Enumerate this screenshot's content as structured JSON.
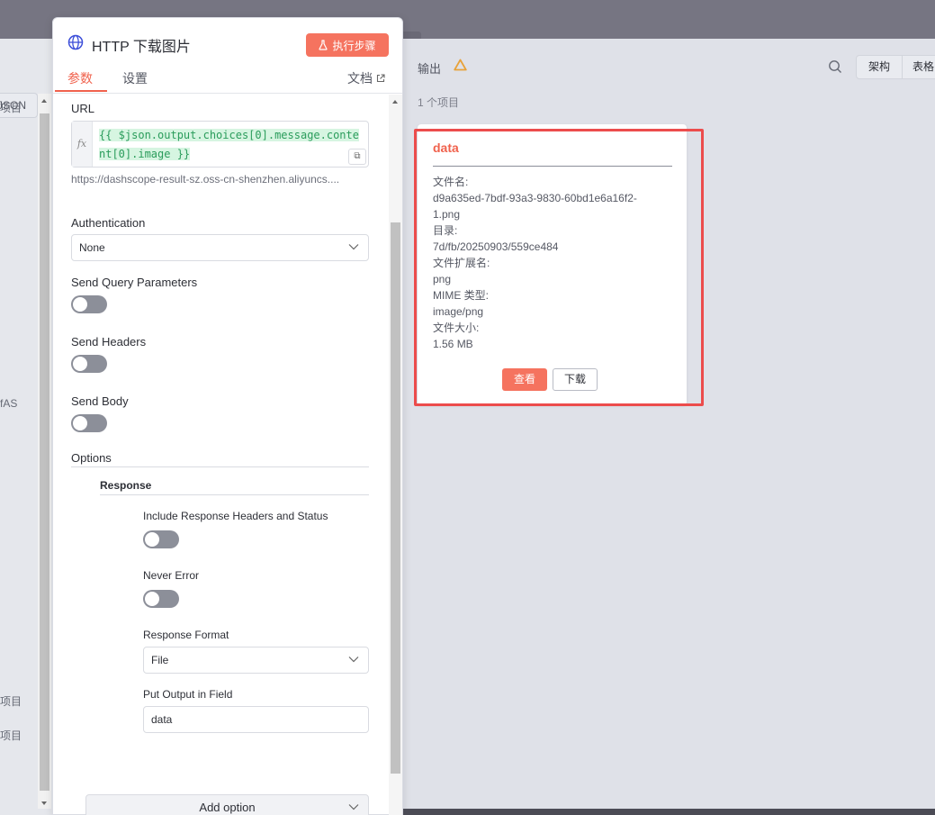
{
  "colors": {
    "accent": "#f0624d",
    "highlight": "#ec4c4c",
    "toggle_off": "#8c8f99",
    "warning": "#e8a23a"
  },
  "left_pane": {
    "json_label": "JSON",
    "items_top": "项目",
    "fas_text": "fAS",
    "items_bottom_1": "项目",
    "items_bottom_2": "项目"
  },
  "node_panel": {
    "icon": "globe-icon",
    "title": "HTTP 下载图片",
    "execute_label": "执行步骤",
    "execute_icon": "flask-icon",
    "tabs": [
      {
        "label": "参数",
        "active": true
      },
      {
        "label": "设置",
        "active": false
      }
    ],
    "docs_label": "文档",
    "url": {
      "label": "URL",
      "fx": "fx",
      "expression": "{{ $json.output.choices[0].message.content[0].image }}",
      "preview": "https://dashscope-result-sz.oss-cn-shenzhen.aliyuncs...."
    },
    "authentication": {
      "label": "Authentication",
      "value": "None"
    },
    "send_query": {
      "label": "Send Query Parameters",
      "enabled": false
    },
    "send_headers": {
      "label": "Send Headers",
      "enabled": false
    },
    "send_body": {
      "label": "Send Body",
      "enabled": false
    },
    "options": {
      "label": "Options",
      "response": {
        "label": "Response",
        "include_headers": {
          "label": "Include Response Headers and Status",
          "enabled": false
        },
        "never_error": {
          "label": "Never Error",
          "enabled": false
        },
        "response_format": {
          "label": "Response Format",
          "value": "File"
        },
        "output_field": {
          "label": "Put Output in Field",
          "value": "data"
        }
      },
      "add_option_label": "Add option"
    }
  },
  "output": {
    "label": "输出",
    "item_count": "1 个项目",
    "view_schema": "架构",
    "view_table": "表格",
    "binary": {
      "name": "data",
      "file_name_label": "文件名:",
      "file_name_1": "d9a635ed-7bdf-93a3-9830-60bd1e6a16f2-",
      "file_name_2": "1.png",
      "directory_label": "目录:",
      "directory": "7d/fb/20250903/559ce484",
      "ext_label": "文件扩展名:",
      "ext": "png",
      "mime_label": "MIME 类型:",
      "mime": "image/png",
      "size_label": "文件大小:",
      "size": "1.56 MB",
      "view_label": "查看",
      "download_label": "下载"
    }
  }
}
